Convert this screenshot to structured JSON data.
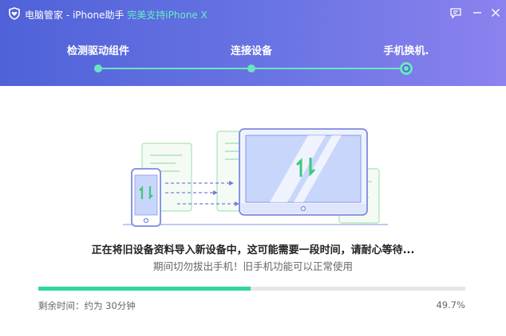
{
  "titlebar": {
    "app_name": "电脑管家 - iPhone助手",
    "highlight": "完美支持iPhone X",
    "icons": {
      "logo": "shield-heart-icon",
      "feedback": "chat-bubble-icon",
      "minimize": "minimize-icon",
      "close": "close-icon"
    }
  },
  "steps": {
    "items": [
      {
        "label": "检测驱动组件",
        "state": "done"
      },
      {
        "label": "连接设备",
        "state": "done"
      },
      {
        "label": "手机换机.",
        "state": "current"
      }
    ]
  },
  "illustration": {
    "icon": "phone-to-computer-transfer-icon"
  },
  "status": {
    "main": "正在将旧设备资料导入新设备中，这可能需要一段时间，请耐心等待...",
    "sub": "期间切勿拔出手机！旧手机功能可以正常使用"
  },
  "progress": {
    "time_left": "剩余时间：约为 30分钟",
    "percent_text": "49.7%",
    "value": 0.497
  },
  "colors": {
    "accent": "#2fd79b",
    "header_start": "#4f62d8",
    "header_end": "#8b82ee",
    "line_color": "#69e6bf"
  }
}
